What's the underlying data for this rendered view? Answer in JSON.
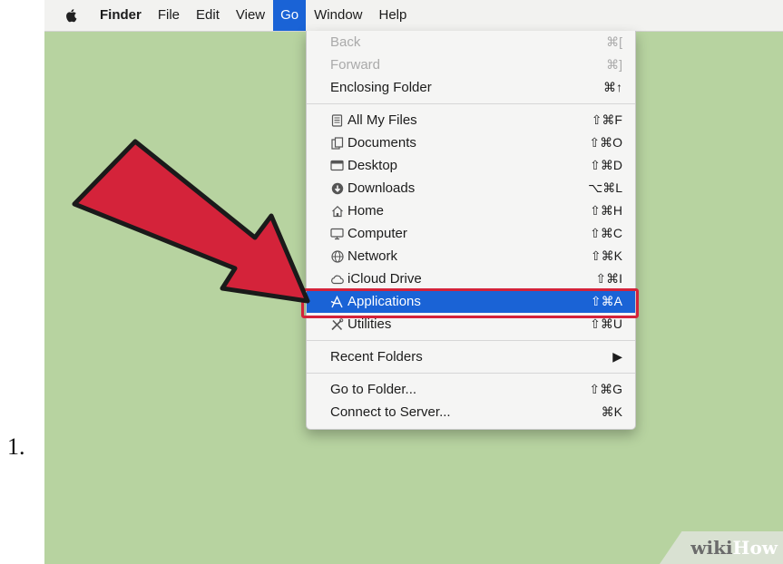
{
  "list_number": "1.",
  "menubar": {
    "items": [
      {
        "label": "Finder"
      },
      {
        "label": "File"
      },
      {
        "label": "Edit"
      },
      {
        "label": "View"
      },
      {
        "label": "Go"
      },
      {
        "label": "Window"
      },
      {
        "label": "Help"
      }
    ]
  },
  "menu": {
    "items": [
      {
        "label": "Back",
        "shortcut": "⌘["
      },
      {
        "label": "Forward",
        "shortcut": "⌘]"
      },
      {
        "label": "Enclosing Folder",
        "shortcut": "⌘↑"
      },
      {
        "label": "All My Files",
        "shortcut": "⇧⌘F"
      },
      {
        "label": "Documents",
        "shortcut": "⇧⌘O"
      },
      {
        "label": "Desktop",
        "shortcut": "⇧⌘D"
      },
      {
        "label": "Downloads",
        "shortcut": "⌥⌘L"
      },
      {
        "label": "Home",
        "shortcut": "⇧⌘H"
      },
      {
        "label": "Computer",
        "shortcut": "⇧⌘C"
      },
      {
        "label": "Network",
        "shortcut": "⇧⌘K"
      },
      {
        "label": "iCloud Drive",
        "shortcut": "⇧⌘I"
      },
      {
        "label": "Applications",
        "shortcut": "⇧⌘A"
      },
      {
        "label": "Utilities",
        "shortcut": "⇧⌘U"
      },
      {
        "label": "Recent Folders",
        "shortcut": "▶"
      },
      {
        "label": "Go to Folder...",
        "shortcut": "⇧⌘G"
      },
      {
        "label": "Connect to Server...",
        "shortcut": "⌘K"
      }
    ]
  },
  "watermark": {
    "part1": "wiki",
    "part2": "How"
  },
  "colors": {
    "highlight": "#1a63d6",
    "arrow": "#d4233a",
    "desktop": "#b7d3a0"
  }
}
